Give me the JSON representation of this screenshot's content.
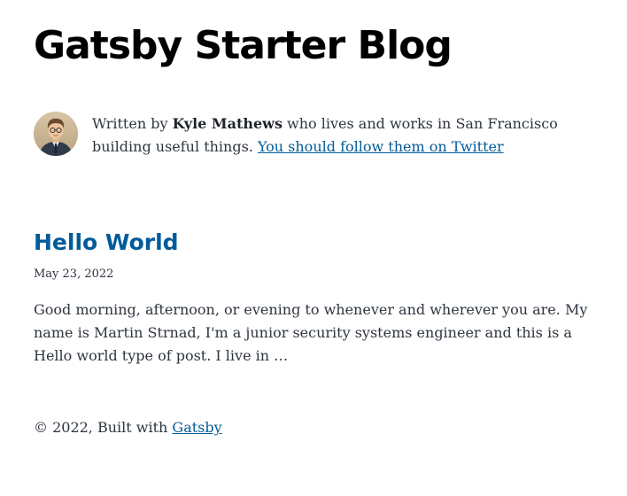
{
  "site": {
    "title": "Gatsby Starter Blog"
  },
  "bio": {
    "prefix": "Written by ",
    "author": "Kyle Mathews",
    "middle": " who lives and works in San Francisco building useful things. ",
    "link_label": "You should follow them on Twitter",
    "avatar_icon": "author-avatar-photo"
  },
  "posts": [
    {
      "title": "Hello World",
      "date": "May 23, 2022",
      "excerpt": "Good morning, afternoon, or evening to whenever and wherever you are. My name is Martin Strnad, I'm a junior security systems engineer and this is a Hello world type of post. I live in …"
    }
  ],
  "footer": {
    "text": "© 2022, Built with ",
    "link_label": "Gatsby"
  },
  "colors": {
    "link": "#005b99",
    "text": "#2e353f",
    "heading": "#000000"
  }
}
